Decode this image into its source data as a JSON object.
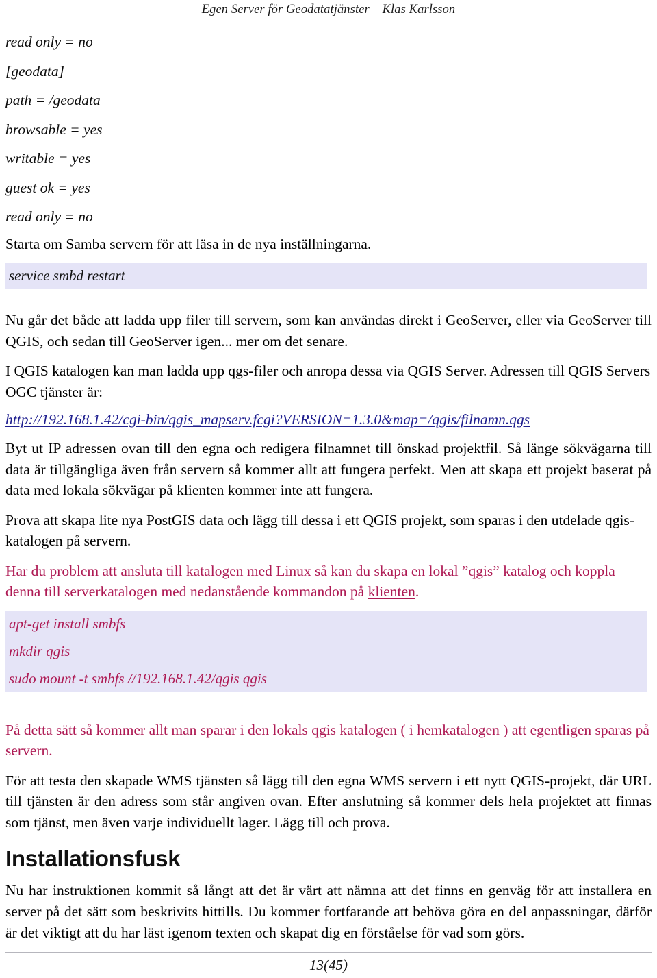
{
  "header": {
    "running_title": "Egen Server för Geodatatjänster – Klas Karlsson"
  },
  "config_listing": {
    "lines": [
      "read only = no",
      "[geodata]",
      "path = /geodata",
      "browsable = yes",
      "writable = yes",
      "guest ok = yes",
      "read only = no"
    ]
  },
  "paragraphs": {
    "restart_intro": "Starta om Samba servern för att läsa in de nya inställningarna.",
    "upload_info": "Nu går det både att ladda upp filer till servern, som kan användas direkt i GeoServer, eller via GeoServer till QGIS, och sedan till GeoServer igen... mer om det senare.",
    "qgis_catalog": "I QGIS katalogen kan man ladda upp qgs-filer och anropa dessa via QGIS Server. Adressen till QGIS Servers OGC tjänster är:",
    "replace_ip": "Byt ut IP adressen ovan till den egna och redigera filnamnet till önskad projektfil. Så länge sökvägarna till data är tillgängliga även från servern så kommer allt att fungera perfekt. Men att skapa ett projekt baserat på data med lokala sökvägar på klienten kommer inte att fungera.",
    "postgis_try": "Prova att skapa lite nya PostGIS data och lägg till dessa i ett QGIS projekt, som sparas i den utdelade qgis-katalogen på servern.",
    "linux_mount_part1": "Har du problem att ansluta till katalogen med Linux så kan du skapa en lokal ”qgis” katalog och koppla denna till serverkatalogen med nedanstående kommandon på ",
    "linux_mount_link": "klienten",
    "linux_mount_part2": ".",
    "local_save_note": "På detta sätt så kommer allt man sparar i den lokals qgis katalogen ( i hemkatalogen ) att egentligen sparas på servern.",
    "wms_test": "För att testa den skapade WMS tjänsten så lägg till den egna WMS servern i ett nytt QGIS-projekt, där URL till tjänsten är den adress som står angiven ovan. Efter anslutning så kommer dels hela projektet att finnas som tjänst, men även varje individuellt lager. Lägg till och prova.",
    "shortcut_intro": "Nu har instruktionen kommit så långt att det är värt att nämna att det finns en genväg för att installera en server på det sätt som beskrivits hittills. Du kommer fortfarande att behöva göra en del anpassningar, därför är det viktigt att du har läst igenom texten och skapat dig en förståelse för vad som görs."
  },
  "code_blocks": {
    "restart_command": {
      "lines": [
        "service smbd restart"
      ]
    },
    "smbfs_mount": {
      "lines": [
        "apt-get install smbfs",
        "mkdir qgis",
        "sudo mount -t smbfs //192.168.1.42/qgis qgis"
      ]
    }
  },
  "service_url": {
    "text": "http://192.168.1.42/cgi-bin/qgis_mapserv.fcgi?VERSION=1.3.0&map=/qgis/filnamn.qgs"
  },
  "headings": {
    "installationsfusk": "Installationsfusk"
  },
  "footer": {
    "page_number": "13(45)"
  },
  "colors": {
    "code_band_background": "#e5e4f7",
    "accent_red": "#ae1a54",
    "link_blue": "#1f1f8f",
    "rule_gray": "#b6b6bd",
    "text_black": "#000000"
  }
}
